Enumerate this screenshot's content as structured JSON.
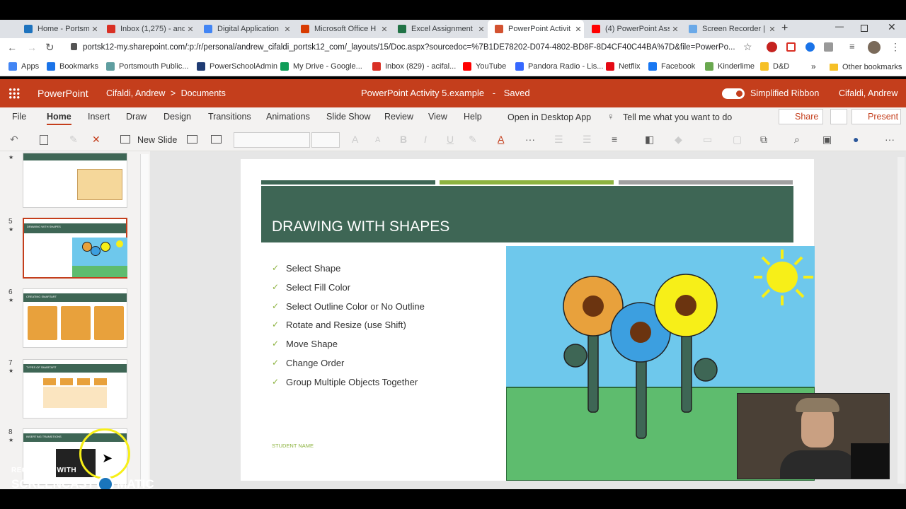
{
  "browser": {
    "tabs": [
      {
        "title": "Home - Portsmouth",
        "color": "#1e73be"
      },
      {
        "title": "Inbox (1,275) - and",
        "color": "#d93025"
      },
      {
        "title": "Digital Application",
        "color": "#4285f4"
      },
      {
        "title": "Microsoft Office H",
        "color": "#d83b01"
      },
      {
        "title": "Excel Assignment",
        "color": "#217346"
      },
      {
        "title": "PowerPoint Activit",
        "color": "#d35230"
      },
      {
        "title": "(4) PowerPoint Ass",
        "color": "#ff0000"
      },
      {
        "title": "Screen Recorder |",
        "color": "#6aa9e8"
      }
    ],
    "url": "portsk12-my.sharepoint.com/:p:/r/personal/andrew_cifaldi_portsk12_com/_layouts/15/Doc.aspx?sourcedoc=%7B1DE78202-D074-4802-BD8F-8D4CF40C44BA%7D&file=PowerPo...",
    "bookmarks": [
      {
        "label": "Apps",
        "color": "#4285f4"
      },
      {
        "label": "Bookmarks",
        "color": "#1a73e8"
      },
      {
        "label": "Portsmouth Public...",
        "color": "#5f9ea0"
      },
      {
        "label": "PowerSchoolAdmin",
        "color": "#1f3b73"
      },
      {
        "label": "My Drive - Google...",
        "color": "#0f9d58"
      },
      {
        "label": "Inbox (829) - acifal...",
        "color": "#d93025"
      },
      {
        "label": "YouTube",
        "color": "#ff0000"
      },
      {
        "label": "Pandora Radio - Lis...",
        "color": "#3668ff"
      },
      {
        "label": "Netflix",
        "color": "#e50914"
      },
      {
        "label": "Facebook",
        "color": "#1877f2"
      },
      {
        "label": "Kinderlime",
        "color": "#6aa84f"
      },
      {
        "label": "D&D",
        "color": "#f6c026"
      }
    ],
    "bookmarks_overflow": "»",
    "other_bookmarks": "Other bookmarks"
  },
  "office": {
    "app_name": "PowerPoint",
    "breadcrumb_user": "Cifaldi, Andrew",
    "breadcrumb_sep": ">",
    "breadcrumb_folder": "Documents",
    "doc_title": "PowerPoint Activity 5.example",
    "doc_sep": "-",
    "doc_status": "Saved",
    "simplified_ribbon": "Simplified Ribbon",
    "user": "Cifaldi, Andrew"
  },
  "menu": {
    "items": [
      "File",
      "Home",
      "Insert",
      "Draw",
      "Design",
      "Transitions",
      "Animations",
      "Slide Show",
      "Review",
      "View",
      "Help"
    ],
    "open_desktop": "Open in Desktop App",
    "tell_me": "Tell me what you want to do",
    "share": "Share",
    "present": "Present"
  },
  "toolbar": {
    "new_slide": "New Slide"
  },
  "thumbnails": [
    {
      "num": "5",
      "title": "DRAWING WITH SHAPES"
    },
    {
      "num": "6",
      "title": "CREATING SMARTART"
    },
    {
      "num": "7",
      "title": "TYPES OF SMARTART"
    },
    {
      "num": "8",
      "title": "INSERTING TRANSITIONS"
    }
  ],
  "slide": {
    "title": "DRAWING WITH SHAPES",
    "bullets": [
      "Select Shape",
      "Select Fill Color",
      "Select Outline Color or No Outline",
      "Rotate and Resize (use Shift)",
      "Move Shape",
      "Change Order",
      "Group Multiple Objects Together"
    ],
    "footer": "STUDENT NAME",
    "colors": {
      "title_bar": "#3e6655",
      "accent_green": "#8db340",
      "accent_grey": "#a0a0a0",
      "sky": "#6ec8ec",
      "grass": "#5ebc6e"
    }
  },
  "watermark": {
    "line1": "RECORDED WITH",
    "line2a": "SCREENCAST",
    "line2b": "MATIC"
  }
}
